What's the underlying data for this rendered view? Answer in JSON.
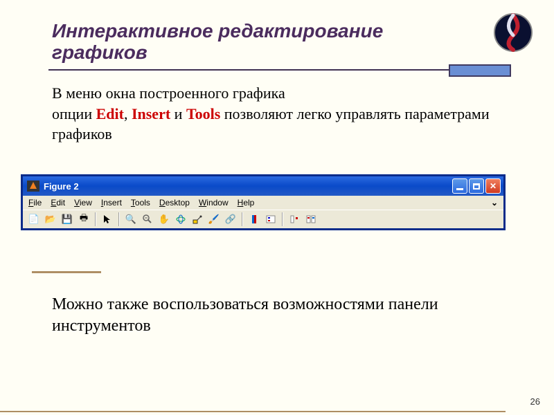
{
  "title_line1": "Интерактивное редактирование",
  "title_line2": "графиков",
  "body": {
    "p1": "В  меню окна построенного графика",
    "p2a": "опции ",
    "edit": "Edit",
    "comma1": ", ",
    "insert": "Insert",
    "and": " и ",
    "tools": "Tools",
    "p2b": " позволяют легко управлять параметрами графиков"
  },
  "figure": {
    "title": "Figure 2",
    "menu": {
      "file": "File",
      "edit": "Edit",
      "view": "View",
      "insert": "Insert",
      "tools": "Tools",
      "desktop": "Desktop",
      "window": "Window",
      "help": "Help"
    },
    "toolbar": {
      "new": "new-page-icon",
      "open": "open-folder-icon",
      "save": "save-icon",
      "print": "print-icon",
      "pointer": "pointer-icon",
      "zoomin": "zoom-in-icon",
      "zoomout": "zoom-out-icon",
      "pan": "pan-hand-icon",
      "rotate": "rotate-3d-icon",
      "datacursor": "data-cursor-icon",
      "colorbar": "colorbar-icon",
      "brush": "brush-icon",
      "link": "link-icon",
      "annot": "annotation-icon",
      "legend": "legend-icon",
      "hide": "hide-plot-icon",
      "show": "show-plot-icon"
    }
  },
  "body2": "Можно также воспользоваться возможностями панели инструментов",
  "page": "26"
}
